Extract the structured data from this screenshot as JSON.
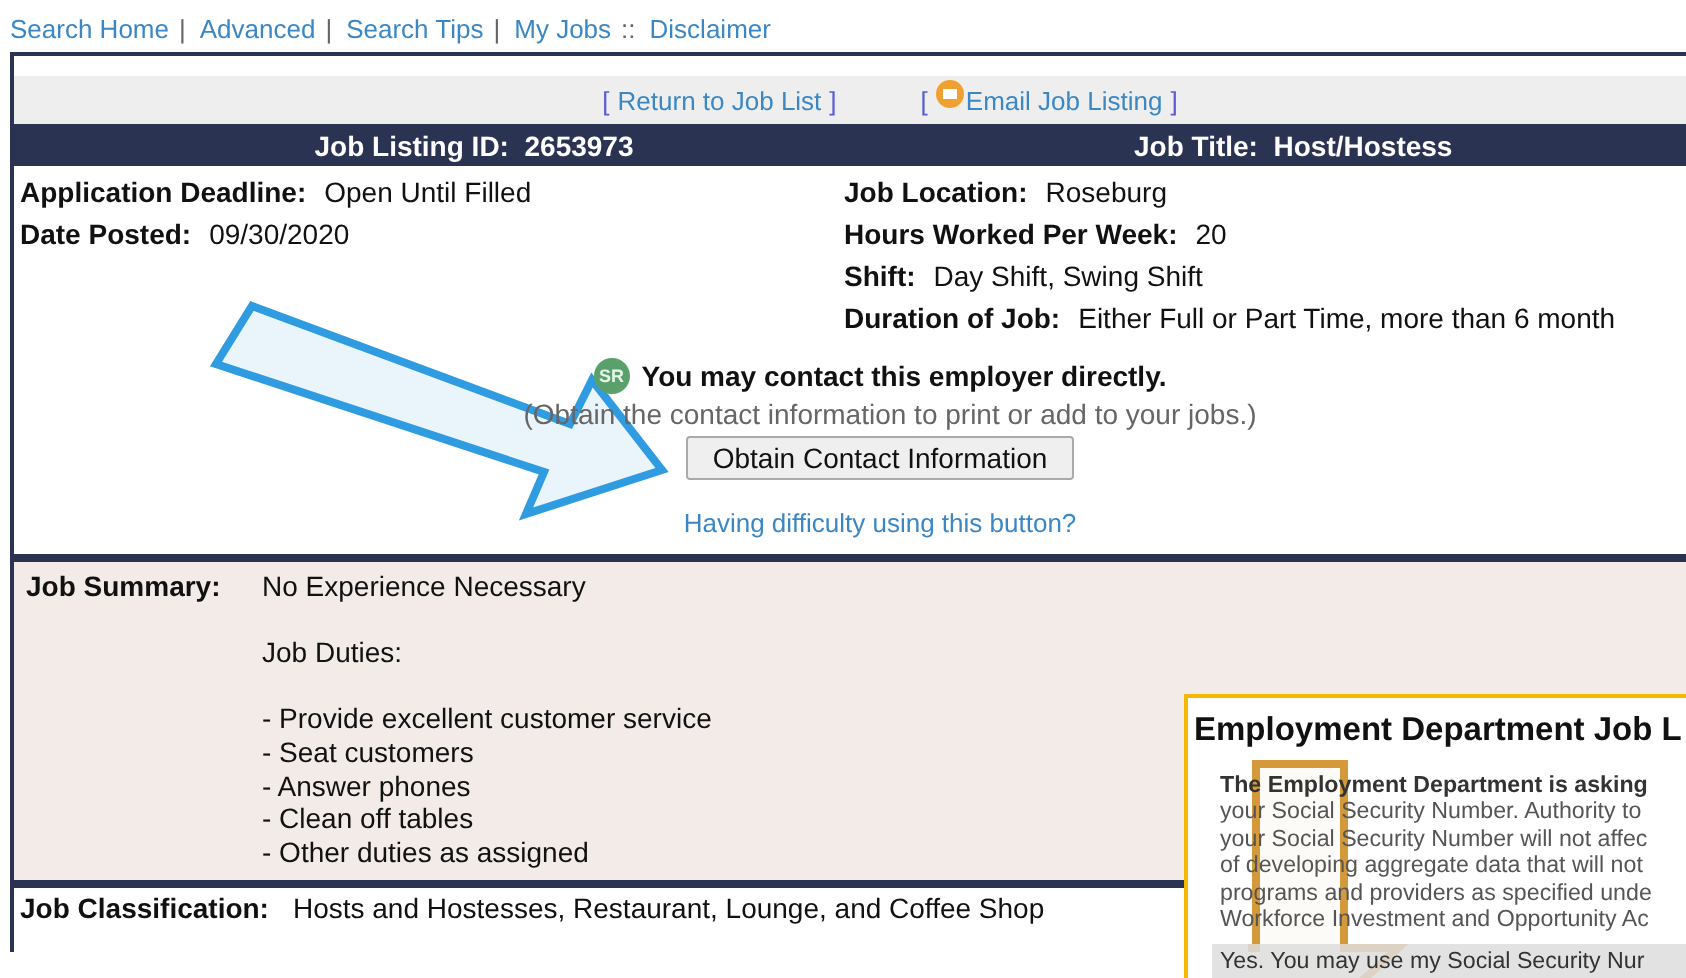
{
  "nav": [
    {
      "label": "Search Home",
      "separator": "|"
    },
    {
      "label": "Advanced",
      "separator": "|"
    },
    {
      "label": "Search Tips",
      "separator": "|"
    },
    {
      "label": "My Jobs",
      "separator": "::"
    },
    {
      "label": "Disclaimer"
    }
  ],
  "actions": [
    {
      "kind": "plain",
      "open": "[",
      "label": "Return to Job List",
      "close": "]"
    },
    {
      "kind": "email",
      "open": "[",
      "label": "Email Job Listing",
      "close": "]"
    }
  ],
  "header": [
    {
      "label": "Job Listing ID:",
      "value": "2653973"
    },
    {
      "label": "Job Title:",
      "value": "Host/Hostess"
    }
  ],
  "details_left": [
    {
      "label": "Application Deadline:",
      "value": "Open Until Filled"
    },
    {
      "label": "Date Posted:",
      "value": "09/30/2020"
    }
  ],
  "details_right": [
    {
      "label": "Job Location:",
      "value": "Roseburg"
    },
    {
      "label": "Hours Worked Per Week:",
      "value": "20"
    },
    {
      "label": "Shift:",
      "value": "Day Shift, Swing Shift"
    },
    {
      "label": "Duration of Job:",
      "value": "Either Full or Part Time, more than 6 month"
    }
  ],
  "contact": {
    "badge": "SR",
    "message": "You may contact this employer directly.",
    "note": "(Obtain the contact information to print or add to your jobs.)",
    "button": "Obtain Contact Information",
    "help_link": "Having difficulty using this button?"
  },
  "summary": {
    "label": "Job Summary:",
    "paragraphs": [
      [
        "No Experience Necessary"
      ],
      [
        "Job Duties:"
      ],
      [
        "- Provide excellent customer service",
        "- Seat customers",
        "- Answer phones",
        "- Clean off tables",
        "- Other duties as assigned"
      ]
    ]
  },
  "classification": {
    "label": "Job Classification:",
    "value": "Hosts and Hostesses, Restaurant, Lounge, and Coffee Shop"
  },
  "popup": {
    "title": "Employment Department Job L",
    "intro_bold": "The Employment Department is asking",
    "lines": [
      "your Social Security Number. Authority to",
      "your Social Security Number will not affec",
      "of developing aggregate data that will not",
      "programs and providers as specified unde",
      "Workforce Investment and Opportunity Ac"
    ],
    "consent": "Yes. You may use my Social Security Nur"
  }
}
